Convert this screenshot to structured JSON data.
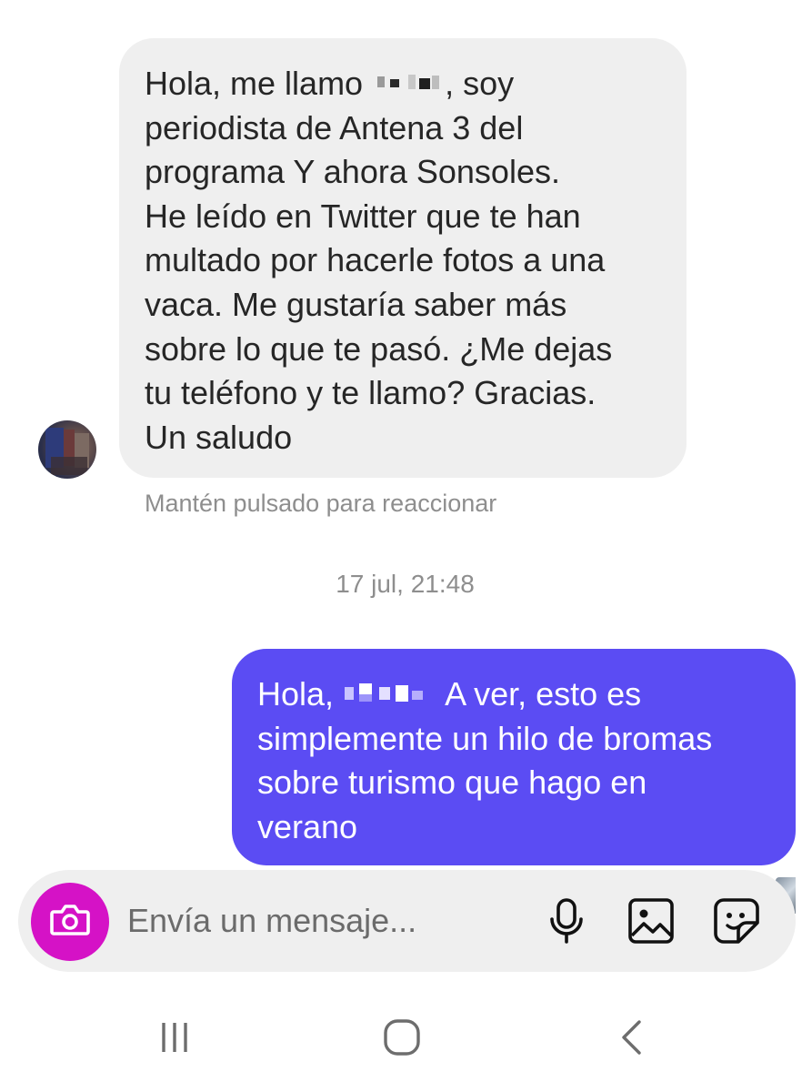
{
  "conversation": {
    "incoming_message": {
      "lines": [
        {
          "before": "Hola, me llamo ",
          "after": ", soy"
        },
        "periodista de Antena 3 del",
        "programa Y ahora Sonsoles.",
        "He leído en Twitter que te han",
        "multado por hacerle fotos a una",
        "vaca. Me gustaría saber más",
        "sobre lo que te pasó. ¿Me dejas",
        "tu teléfono y te llamo? Gracias.",
        "Un saludo"
      ]
    },
    "reaction_hint": "Mantén pulsado para reaccionar",
    "timestamp": "17 jul, 21:48",
    "outgoing_message": {
      "lines": [
        {
          "before": "Hola, ",
          "after": " A ver, esto es"
        },
        "simplemente un hilo de bromas",
        "sobre turismo que hago en",
        "verano"
      ]
    }
  },
  "composer": {
    "placeholder": "Envía un mensaje...",
    "accent_color": "#d512c6"
  },
  "colors": {
    "outgoing_bubble": "#5b4cf3",
    "incoming_bubble": "#efefef",
    "muted_text": "#8e8e8e"
  },
  "icons": {
    "camera": "camera-icon",
    "mic": "microphone-icon",
    "gallery": "gallery-icon",
    "sticker": "sticker-icon",
    "recent": "recent-apps-icon",
    "home": "home-icon",
    "back": "back-icon"
  }
}
